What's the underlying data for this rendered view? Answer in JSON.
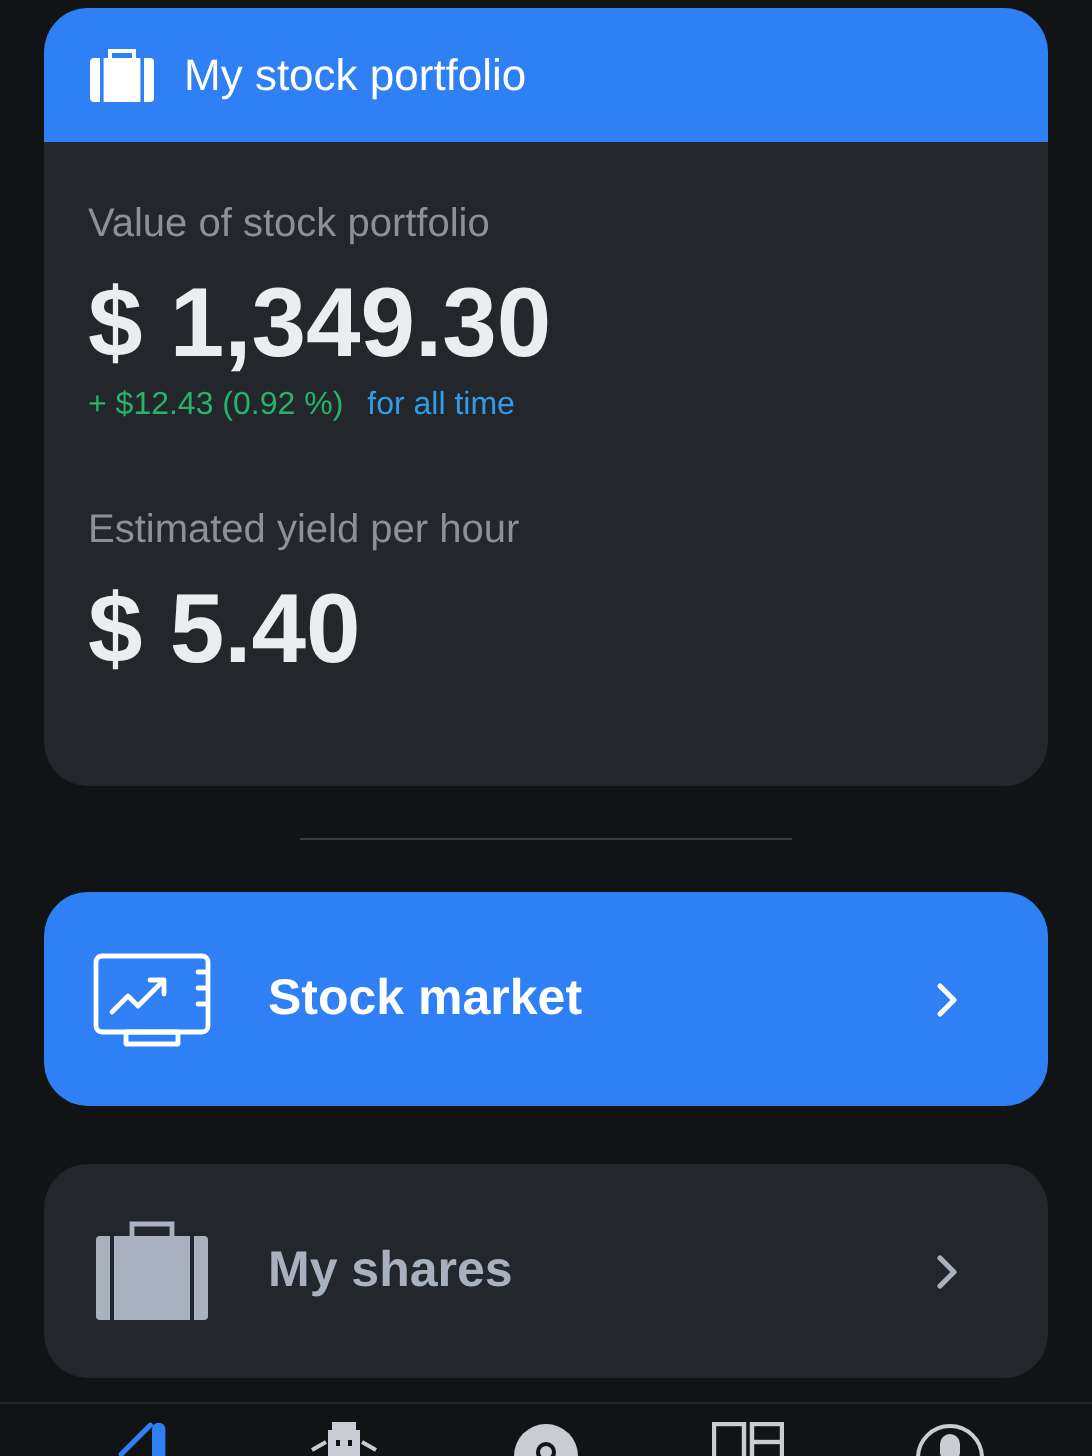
{
  "portfolio_card": {
    "title": "My stock portfolio",
    "value_label": "Value of stock portfolio",
    "value": "$ 1,349.30",
    "change": "+ $12.43 (0.92 %)",
    "change_period": "for all time",
    "yield_label": "Estimated yield per hour",
    "yield": "$ 5.40"
  },
  "menu": [
    {
      "kind": "chart",
      "label": "Stock market",
      "highlighted": true
    },
    {
      "kind": "briefcase",
      "label": "My shares",
      "highlighted": false
    }
  ],
  "bottom_nav": [
    {
      "kind": "chart",
      "selected": true
    },
    {
      "kind": "building",
      "selected": false
    },
    {
      "kind": "coin",
      "selected": false
    },
    {
      "kind": "panels",
      "selected": false
    },
    {
      "kind": "profile",
      "selected": false
    }
  ]
}
